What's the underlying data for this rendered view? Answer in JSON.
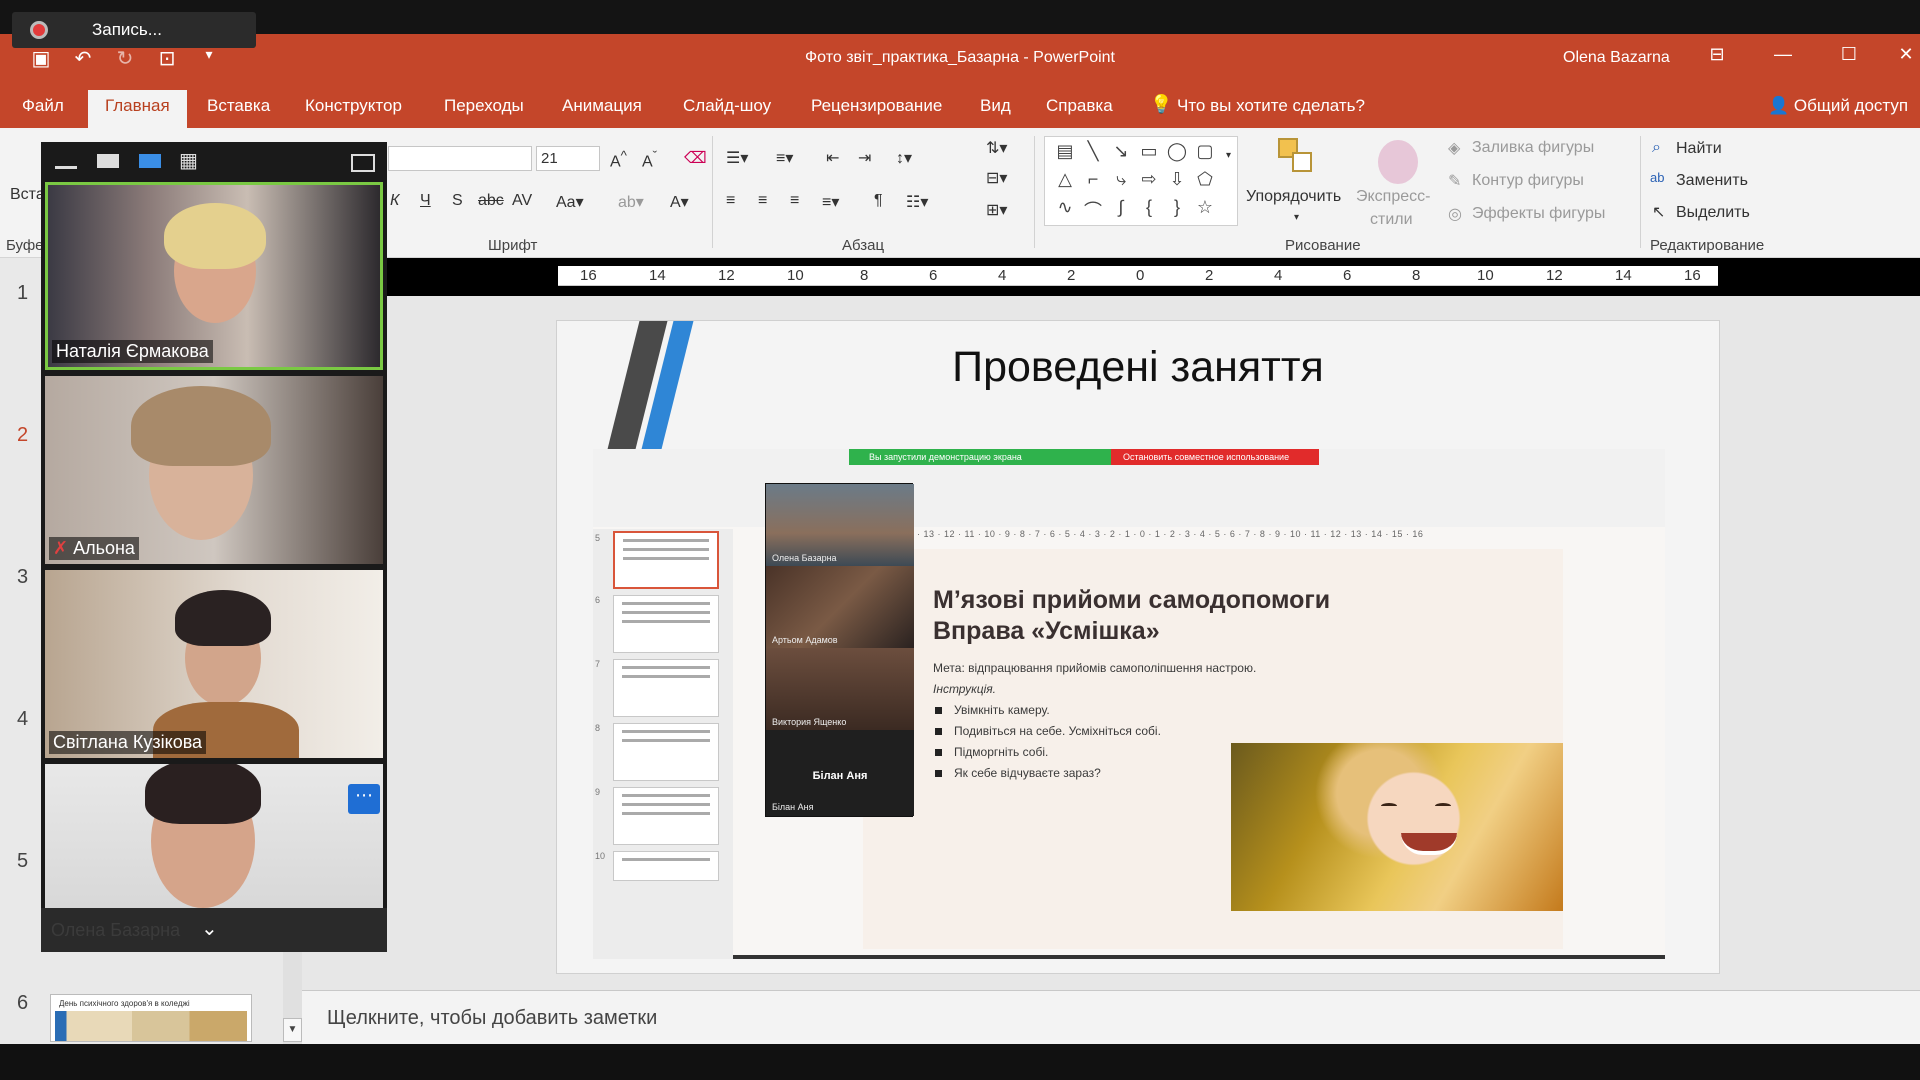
{
  "recording": {
    "label": "Запись..."
  },
  "window": {
    "title": "Фото звіт_практика_Базарна  -  PowerPoint",
    "user": "Olena Bazarna"
  },
  "tabs": [
    "Файл",
    "Главная",
    "Вставка",
    "Конструктор",
    "Переходы",
    "Анимация",
    "Слайд-шоу",
    "Рецензирование",
    "Вид",
    "Справка"
  ],
  "tell_me": "Что вы хотите сделать?",
  "share": "Общий доступ",
  "ribbon": {
    "paste_label": "Вста",
    "clipboard_group": "Буфе",
    "font_size": "21",
    "font_group": "Шрифт",
    "paragraph_group": "Абзац",
    "drawing_group": "Рисование",
    "editing_group": "Редактирование",
    "arrange": "Упорядочить",
    "quick_styles_1": "Экспресс-",
    "quick_styles_2": "стили",
    "shape_fill": "Заливка фигуры",
    "shape_outline": "Контур фигуры",
    "shape_effects": "Эффекты фигуры",
    "find": "Найти",
    "replace": "Заменить",
    "select": "Выделить"
  },
  "ruler_marks": [
    "16",
    "14",
    "12",
    "10",
    "8",
    "6",
    "4",
    "2",
    "0",
    "2",
    "4",
    "6",
    "8",
    "10",
    "12",
    "14",
    "16"
  ],
  "slide_numbers": [
    "1",
    "2",
    "3",
    "4",
    "5",
    "6"
  ],
  "thumb6_title": "День психічного здоров'я в коледжі",
  "participants": [
    {
      "name": "Наталія  Єрмакова",
      "active": true,
      "muted": false
    },
    {
      "name": "Альона",
      "active": false,
      "muted": true
    },
    {
      "name": "Світлана Кузікова",
      "active": false,
      "muted": false
    },
    {
      "name": "",
      "active": false,
      "muted": false
    }
  ],
  "self_name": "Олена Базарна",
  "slide": {
    "title": "Проведені заняття",
    "inner": {
      "green_bar": "Вы запустили демонстрацию экрана",
      "red_bar": "Остановить совместное использование",
      "heading_1": "М’язові прийоми самодопомоги",
      "heading_2": "Вправа «Усмішка»",
      "goal": "Мета: відпрацювання прийомів самополіпшення настрою.",
      "instruction": "Інструкція.",
      "steps": [
        "Увімкніть камеру.",
        "Подивіться на себе. Усміхніться собі.",
        "Підморгніть собі.",
        "Як себе відчуваєте зараз?"
      ],
      "video_names": [
        "Олена Базарна",
        "Артьом Адамов",
        "Виктория Ященко",
        "Білан Аня"
      ],
      "big_name": "Білан Аня",
      "thumb_numbers": [
        "5",
        "6",
        "7",
        "8",
        "9",
        "10"
      ]
    }
  },
  "notes_placeholder": "Щелкните, чтобы добавить заметки",
  "colors": {
    "accent": "#c4462a",
    "active_speaker": "#7ac943",
    "more_button": "#1f6ed4"
  }
}
